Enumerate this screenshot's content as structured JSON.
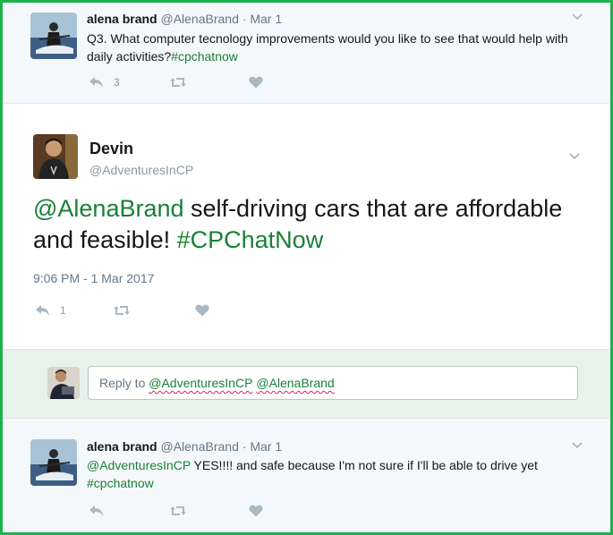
{
  "tweets": {
    "first": {
      "name": "alena brand",
      "handle": "@AlenaBrand",
      "separator": "·",
      "date": "Mar 1",
      "text": "Q3. What computer tecnology improvements would you like to see that would help with daily activities?",
      "hashtag": "#cpchatnow",
      "reply_count": "3"
    },
    "main": {
      "name": "Devin",
      "handle": "@AdventuresInCP",
      "mention": "@AlenaBrand",
      "text": " self-driving cars that are affordable and feasible! ",
      "hashtag": "#CPChatNow",
      "timestamp": "9:06 PM - 1 Mar 2017",
      "reply_count": "1"
    },
    "reply_compose": {
      "prefix": "Reply to ",
      "mention1": "@AdventuresInCP",
      "space": " ",
      "mention2": "@AlenaBrand"
    },
    "last": {
      "name": "alena brand",
      "handle": "@AlenaBrand",
      "separator": "·",
      "date": "Mar 1",
      "mention": "@AdventuresInCP",
      "text": " YES!!!! and safe because I'm not sure if I'll be able to drive yet",
      "hashtag": "#cpchatnow"
    }
  },
  "colors": {
    "border": "#1fb14b",
    "link": "#1a7f37",
    "reply_bg": "#e8f2ec"
  },
  "icons": [
    "reply-icon",
    "retweet-icon",
    "like-icon",
    "chevron-down-icon"
  ]
}
